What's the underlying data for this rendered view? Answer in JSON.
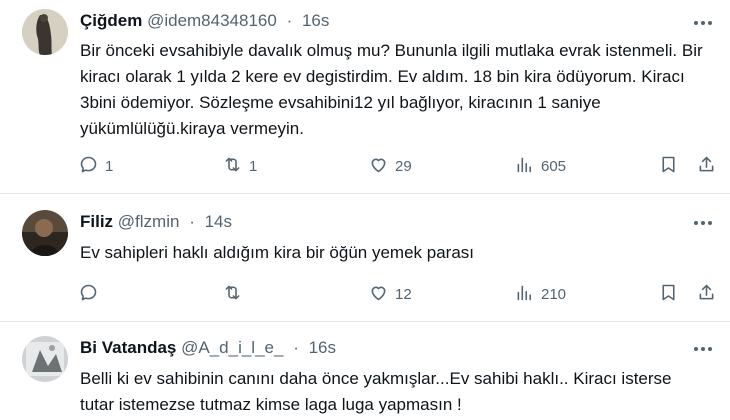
{
  "tweets": [
    {
      "name": "Çiğdem",
      "handle": "@idem84348160",
      "separator": "·",
      "time": "16s",
      "text": "Bir önceki evsahibiyle davalık olmuş mu? Bununla ilgili mutlaka evrak istenmeli. Bir kiracı olarak 1 yılda 2 kere ev degistirdim. Ev aldım. 18 bin kira ödüyorum. Kiracı 3bini ödemiyor. Sözleşme evsahibini12 yıl bağlıyor, kiracının 1 saniye yükümlülüğü.kiraya vermeyin.",
      "replies": "1",
      "retweets": "1",
      "likes": "29",
      "views": "605"
    },
    {
      "name": "Filiz",
      "handle": "@flzmin",
      "separator": "·",
      "time": "14s",
      "text": "Ev sahipleri haklı aldığım kira bir öğün yemek parası",
      "replies": "",
      "retweets": "",
      "likes": "12",
      "views": "210"
    },
    {
      "name": "Bi Vatandaş",
      "handle": "@A_d_i_l_e_",
      "separator": "·",
      "time": "16s",
      "text": "Belli ki ev sahibinin canını daha önce yakmışlar...Ev sahibi haklı.. Kiracı isterse tutar istemezse tutmaz kimse laga luga  yapmasın !"
    }
  ],
  "colors": {
    "text": "#0f1419",
    "muted": "#536471",
    "divider": "#e1e6ea"
  },
  "icons": [
    "more-icon",
    "reply-icon",
    "retweet-icon",
    "like-icon",
    "views-icon",
    "bookmark-icon",
    "share-icon"
  ]
}
